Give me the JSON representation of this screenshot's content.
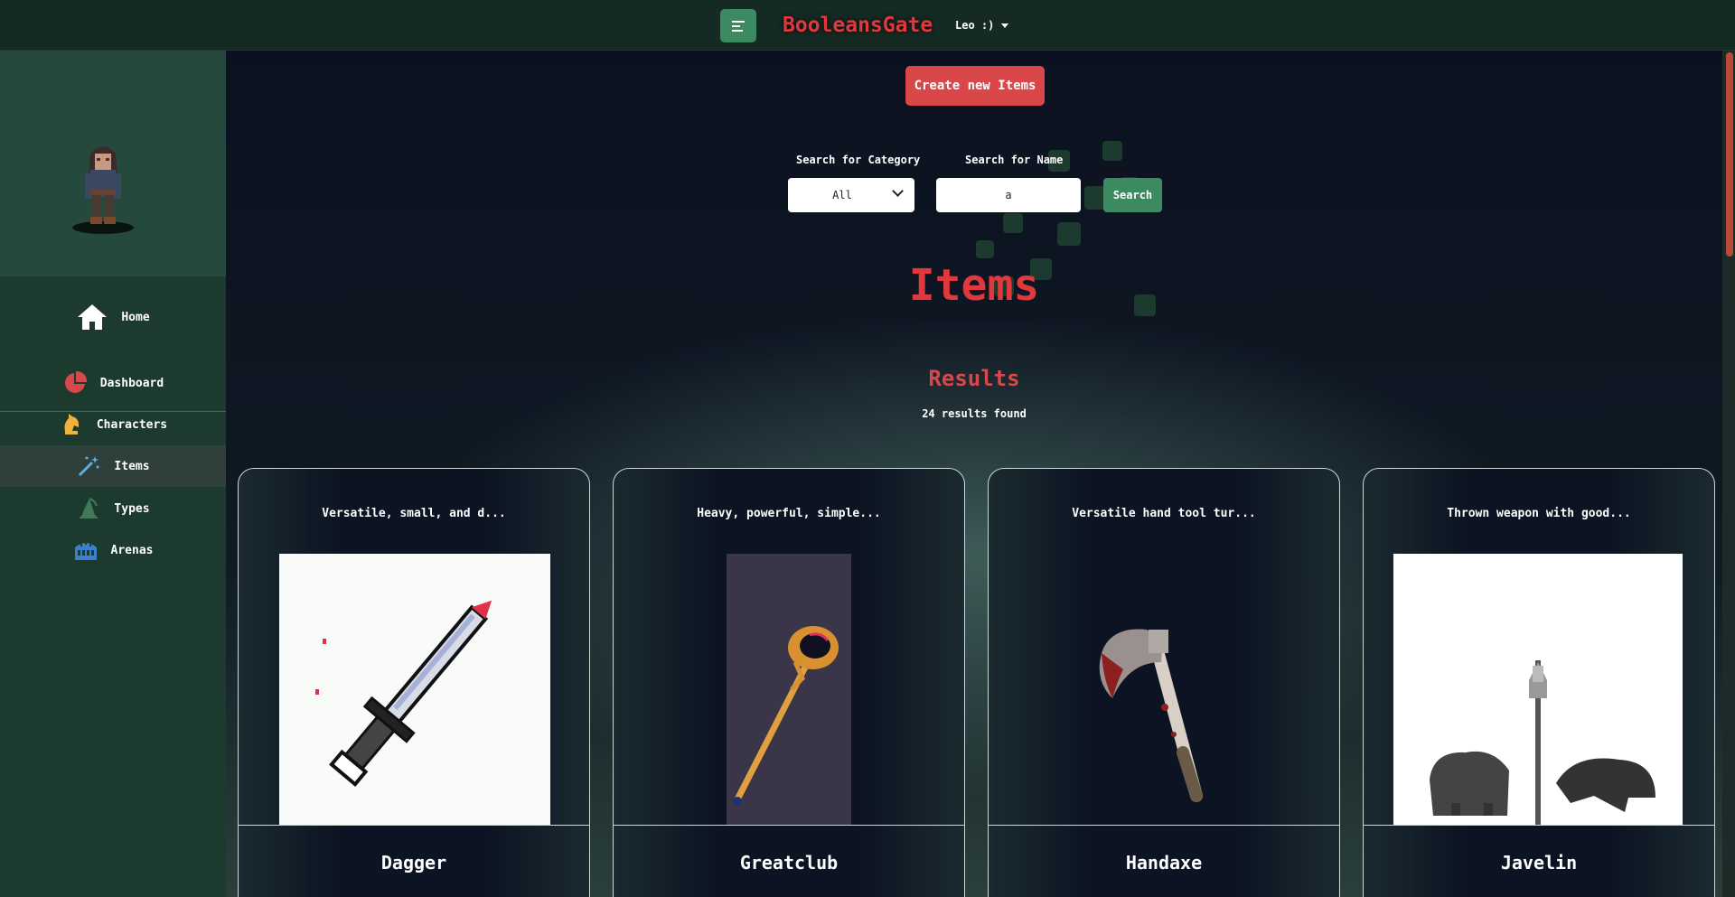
{
  "topbar": {
    "menu_icon": "menu-lines-icon",
    "brand": "BooleansGate",
    "user": "Leo :)"
  },
  "sidebar": {
    "home": {
      "label": "Home",
      "icon": "home-icon"
    },
    "items": [
      {
        "label": "Dashboard",
        "icon": "pie-chart-icon",
        "active": false
      },
      {
        "label": "Characters",
        "icon": "chess-knight-icon",
        "active": false
      },
      {
        "label": "Items",
        "icon": "magic-wand-icon",
        "active": true
      },
      {
        "label": "Types",
        "icon": "wizard-hat-icon",
        "active": false
      },
      {
        "label": "Arenas",
        "icon": "colosseum-icon",
        "active": false
      }
    ]
  },
  "main": {
    "create_button": "Create new Items",
    "search": {
      "category_label": "Search for Category",
      "category_value": "All",
      "name_label": "Search for Name",
      "name_value": "a",
      "button": "Search"
    },
    "title": "Items",
    "results_title": "Results",
    "results_count": "24 results found",
    "cards": [
      {
        "desc": "Versatile, small, and d...",
        "name": "Dagger"
      },
      {
        "desc": "Heavy, powerful, simple...",
        "name": "Greatclub"
      },
      {
        "desc": "Versatile hand tool tur...",
        "name": "Handaxe"
      },
      {
        "desc": "Thrown weapon with good...",
        "name": "Javelin"
      }
    ]
  },
  "colors": {
    "brand_red": "#e0383c",
    "accent_green": "#3c8a5f",
    "sidebar_bg": "#1c3a2e"
  }
}
